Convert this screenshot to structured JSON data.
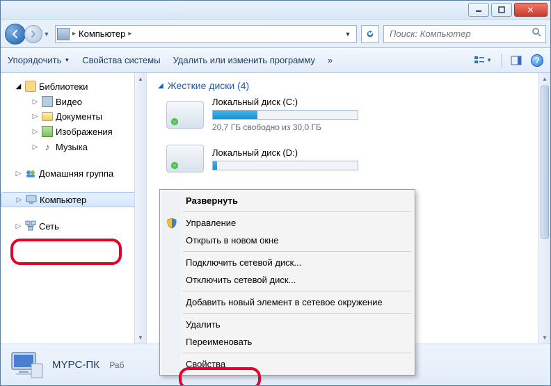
{
  "address": {
    "location": "Компьютер"
  },
  "search": {
    "placeholder": "Поиск: Компьютер"
  },
  "toolbar": {
    "organize": "Упорядочить",
    "system_props": "Свойства системы",
    "uninstall": "Удалить или изменить программу",
    "overflow": "»"
  },
  "sidebar": {
    "libraries": {
      "label": "Библиотеки",
      "video": "Видео",
      "documents": "Документы",
      "pictures": "Изображения",
      "music": "Музыка"
    },
    "homegroup": "Домашняя группа",
    "computer": "Компьютер",
    "network": "Сеть"
  },
  "main": {
    "section_title": "Жесткие диски (4)",
    "drives": [
      {
        "name": "Локальный диск (C:)",
        "free_text": "20,7 ГБ свободно из 30,0 ГБ",
        "fill_pct": 31
      },
      {
        "name": "Локальный диск (D:)",
        "free_text": "",
        "fill_pct": 3
      }
    ]
  },
  "ctx": {
    "expand": "Развернуть",
    "manage": "Управление",
    "open_new": "Открыть в новом окне",
    "map_drive": "Подключить сетевой диск...",
    "unmap_drive": "Отключить сетевой диск...",
    "add_net_loc": "Добавить новый элемент в сетевое окружение",
    "delete": "Удалить",
    "rename": "Переименовать",
    "properties": "Свойства"
  },
  "details": {
    "name": "MYPC-ПК",
    "sub": "Раб"
  }
}
